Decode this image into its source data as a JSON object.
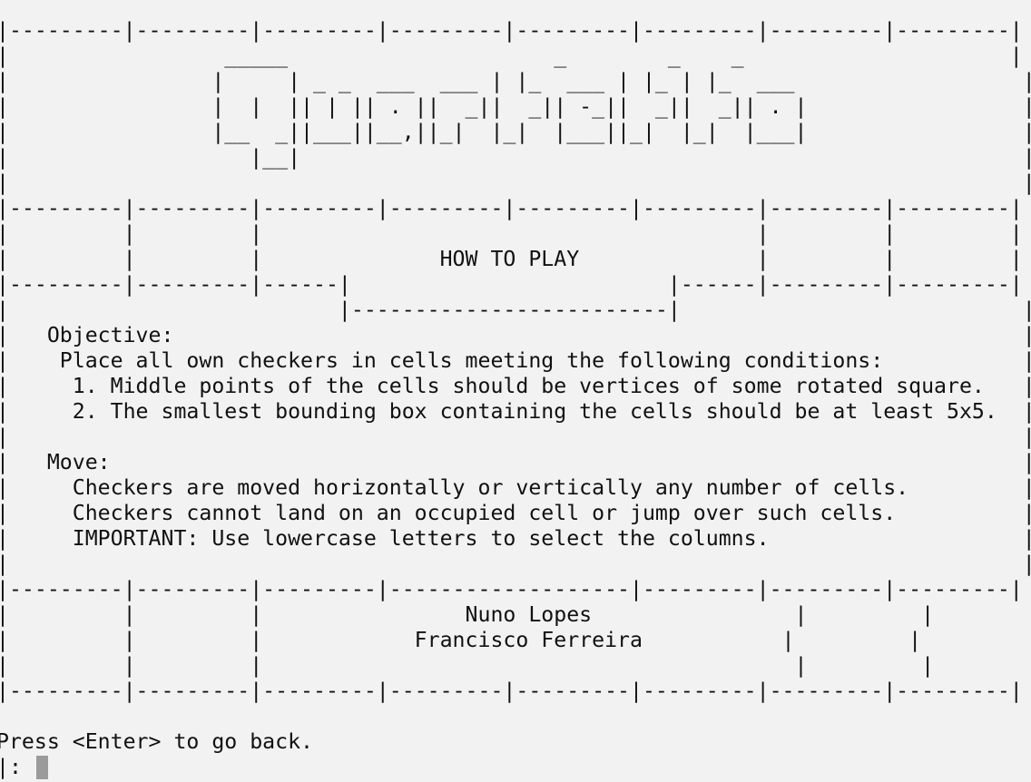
{
  "screen_lines": [
    "|---------|---------|---------|---------|---------|---------|---------|---------|",
    "|                 _____                     _        _    _                     |",
    "|                |     | _ _  ___  ___ | |_  ___ | |_ | |_  ___                  |",
    "|                |  |  || | || . ||  _||  _|| -_||  _||  _|| . |                 |",
    "|                |__  _||___||__,||_|  |_|  |___||_|  |_|  |___|                 |",
    "|                   |__|                                                         |",
    "|                                                                                |",
    "|---------|---------|---------|---------|---------|---------|---------|---------|",
    "|         |         |                                       |         |         |",
    "|         |         |              HOW TO PLAY              |         |         |",
    "|---------|---------|------|                         |------|---------|---------|",
    "|                          |-------------------------|                           |",
    "|   Objective:                                                                   |",
    "|    Place all own checkers in cells meeting the following conditions:           |",
    "|     1. Middle points of the cells should be vertices of some rotated square.   |",
    "|     2. The smallest bounding box containing the cells should be at least 5x5.  |",
    "|                                                                                |",
    "|   Move:                                                                        |",
    "|     Checkers are moved horizontally or vertically any number of cells.         |",
    "|     Checkers cannot land on an occupied cell or jump over such cells.          |",
    "|     IMPORTANT: Use lowercase letters to select the columns.                    |",
    "|                                                                                |",
    "|---------|---------|---------|-------------------|---------|---------|---------|",
    "|         |         |                Nuno Lopes                |         |         |",
    "|         |         |            Francisco Ferreira           |         |         |",
    "|         |         |                                          |         |         |",
    "|---------|---------|---------|---------|---------|---------|---------|---------|",
    "",
    "Press <Enter> to go back.",
    "|: "
  ]
}
